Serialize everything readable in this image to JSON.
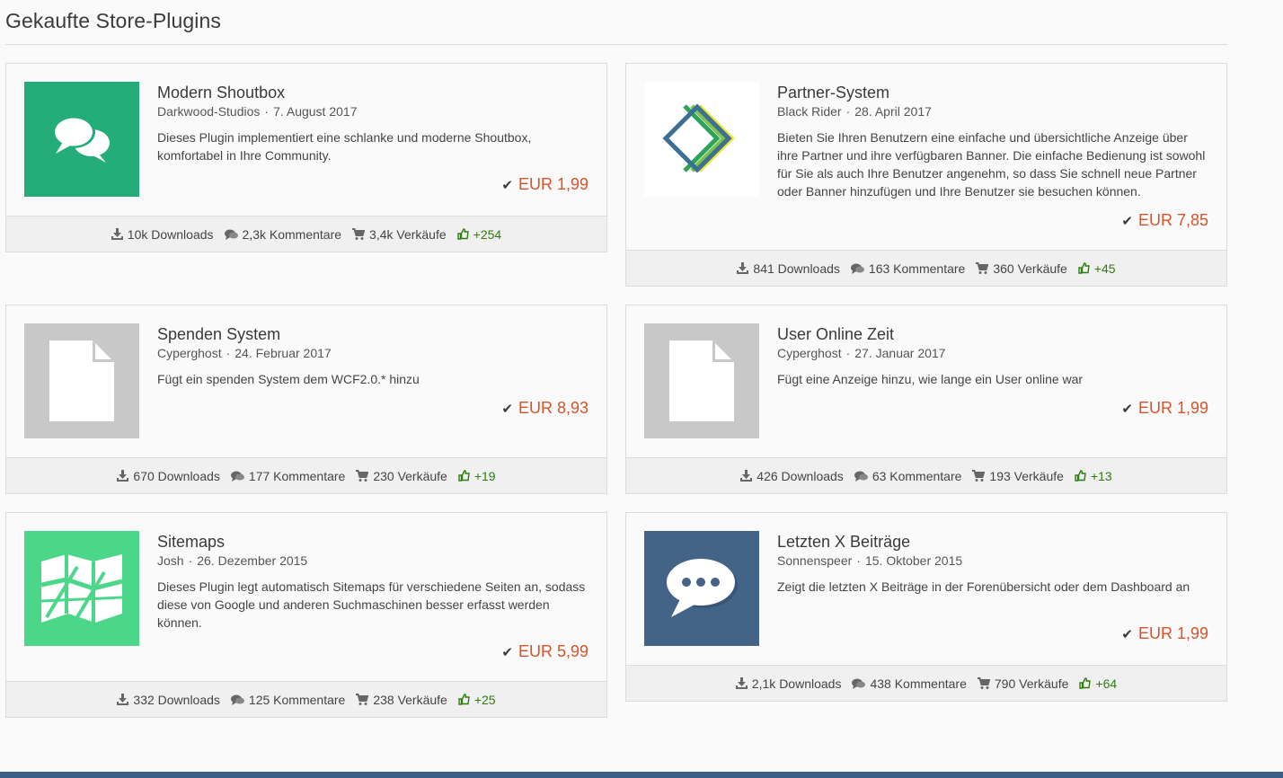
{
  "page_title": "Gekaufte Store-Plugins",
  "colors": {
    "price": "#d4542a",
    "likes": "#2e7d10",
    "footer_bar": "#3b5f86"
  },
  "plugins": [
    {
      "title": "Modern Shoutbox",
      "author": "Darkwood-Studios",
      "date": "7. August 2017",
      "description": "Dieses Plugin implementiert eine schlanke und moderne Shoutbox, komfortabel in Ihre Community.",
      "price": "EUR 1,99",
      "downloads": "10k Downloads",
      "comments": "2,3k Kommentare",
      "sales": "3,4k Verkäufe",
      "likes": "+254",
      "icon": "speech-bubbles-icon"
    },
    {
      "title": "Partner-System",
      "author": "Black Rider",
      "date": "28. April 2017",
      "description": "Bieten Sie Ihren Benutzern eine einfache und übersichtliche Anzeige über ihre Partner und ihre verfügbaren Banner. Die einfache Bedienung ist sowohl für Sie als auch Ihre Benutzer angenehm, so dass Sie schnell neue Partner oder Banner hinzufügen und Ihre Benutzer sie besuchen können.",
      "price": "EUR 7,85",
      "downloads": "841 Downloads",
      "comments": "163 Kommentare",
      "sales": "360 Verkäufe",
      "likes": "+45",
      "icon": "diamond-chevrons-icon"
    },
    {
      "title": "Spenden System",
      "author": "Cyperghost",
      "date": "24. Februar 2017",
      "description": "Fügt ein spenden System dem WCF2.0.* hinzu",
      "price": "EUR 8,93",
      "downloads": "670 Downloads",
      "comments": "177 Kommentare",
      "sales": "230 Verkäufe",
      "likes": "+19",
      "icon": "file-icon"
    },
    {
      "title": "User Online Zeit",
      "author": "Cyperghost",
      "date": "27. Januar 2017",
      "description": "Fügt eine Anzeige hinzu, wie lange ein User online war",
      "price": "EUR 1,99",
      "downloads": "426 Downloads",
      "comments": "63 Kommentare",
      "sales": "193 Verkäufe",
      "likes": "+13",
      "icon": "file-icon"
    },
    {
      "title": "Sitemaps",
      "author": "Josh",
      "date": "26. Dezember 2015",
      "description": "Dieses Plugin legt automatisch Sitemaps für verschiedene Seiten an, sodass diese von Google und anderen Suchmaschinen besser erfasst werden können.",
      "price": "EUR 5,99",
      "downloads": "332 Downloads",
      "comments": "125 Kommentare",
      "sales": "238 Verkäufe",
      "likes": "+25",
      "icon": "map-icon"
    },
    {
      "title": "Letzten X Beiträge",
      "author": "Sonnenspeer",
      "date": "15. Oktober 2015",
      "description": "Zeigt die letzten X Beiträge in der Forenübersicht oder dem Dashboard an",
      "price": "EUR 1,99",
      "downloads": "2,1k Downloads",
      "comments": "438 Kommentare",
      "sales": "790 Verkäufe",
      "likes": "+64",
      "icon": "chat-bubble-dots-icon"
    }
  ]
}
